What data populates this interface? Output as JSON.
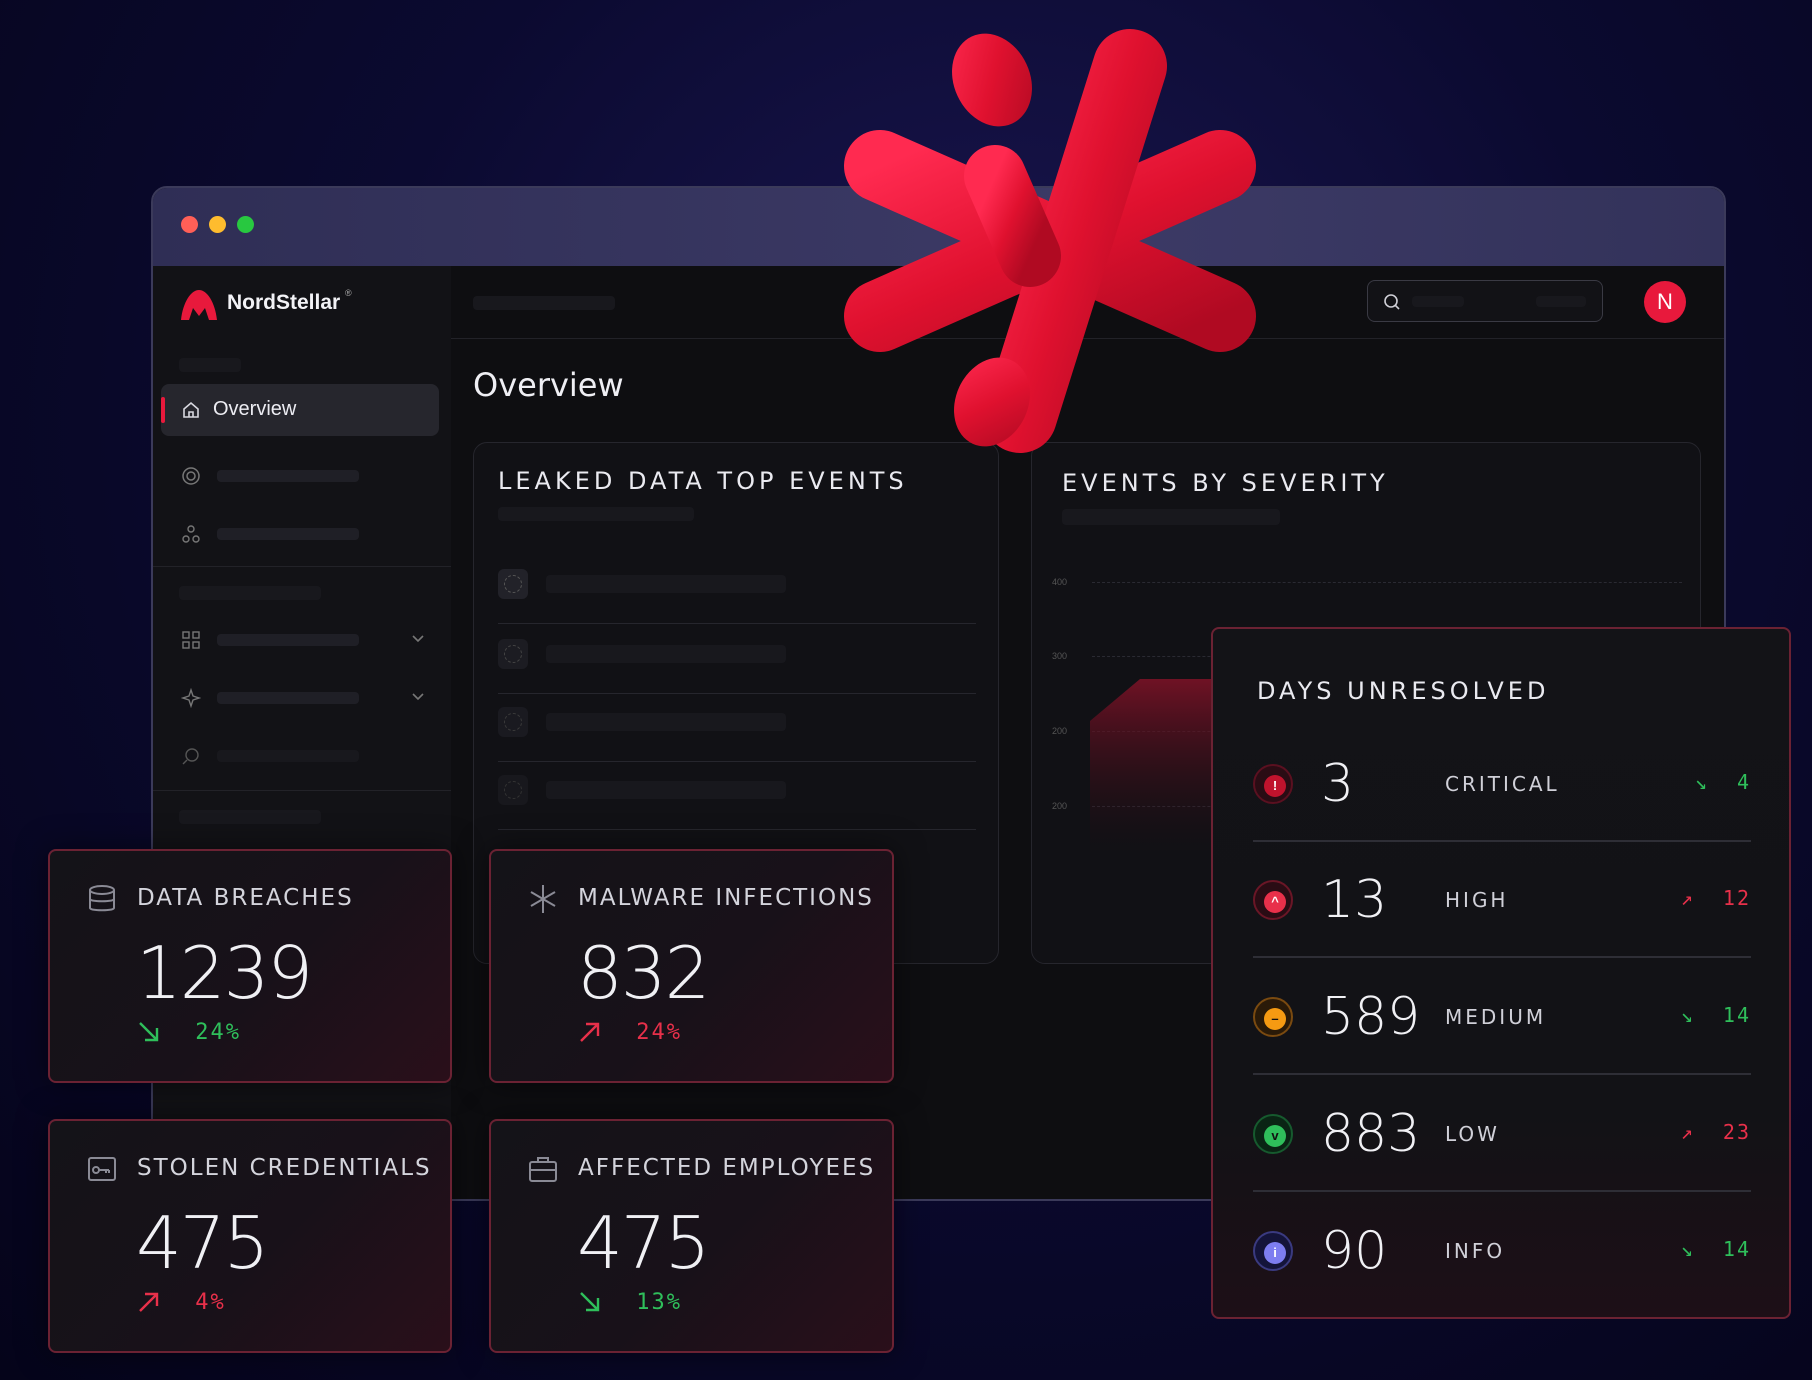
{
  "window": {
    "controls": {
      "close_color": "#ff5f57",
      "minimize_color": "#febc2e",
      "maximize_color": "#28c840"
    }
  },
  "brand": {
    "name": "NordStellar",
    "trademark": "®",
    "accent": "#e8193c"
  },
  "sidebar": {
    "items": [
      {
        "label": "Overview",
        "icon": "home-icon",
        "active": true
      }
    ]
  },
  "header": {
    "avatar_letter": "N"
  },
  "main": {
    "page_title": "Overview"
  },
  "leaked_panel": {
    "title": "LEAKED DATA TOP EVENTS"
  },
  "severity_panel": {
    "title": "EVENTS BY SEVERITY",
    "y_ticks": [
      "400",
      "300",
      "200",
      "200"
    ]
  },
  "stats": {
    "data_breaches": {
      "label": "DATA BREACHES",
      "value": "1239",
      "trend": "24%",
      "direction": "down",
      "icon": "database-icon"
    },
    "malware": {
      "label": "MALWARE INFECTIONS",
      "value": "832",
      "trend": "24%",
      "direction": "up",
      "icon": "asterisk-icon"
    },
    "credentials": {
      "label": "STOLEN CREDENTIALS",
      "value": "475",
      "trend": "4%",
      "direction": "up",
      "icon": "key-card-icon"
    },
    "employees": {
      "label": "AFFECTED EMPLOYEES",
      "value": "475",
      "trend": "13%",
      "direction": "down",
      "icon": "briefcase-icon"
    }
  },
  "days_unresolved": {
    "title": "DAYS UNRESOLVED",
    "rows": [
      {
        "value": "3",
        "label": "CRITICAL",
        "trend": "4",
        "direction": "down",
        "color": "#c0132d",
        "glyph": "!"
      },
      {
        "value": "13",
        "label": "HIGH",
        "trend": "12",
        "direction": "up",
        "color": "#e8304a",
        "glyph": "^"
      },
      {
        "value": "589",
        "label": "MEDIUM",
        "trend": "14",
        "direction": "down",
        "color": "#f59a12",
        "glyph": "–"
      },
      {
        "value": "883",
        "label": "LOW",
        "trend": "23",
        "direction": "up",
        "color": "#2fbf5b",
        "glyph": "v"
      },
      {
        "value": "90",
        "label": "INFO",
        "trend": "14",
        "direction": "down",
        "color": "#7d7df0",
        "glyph": "i"
      }
    ]
  }
}
